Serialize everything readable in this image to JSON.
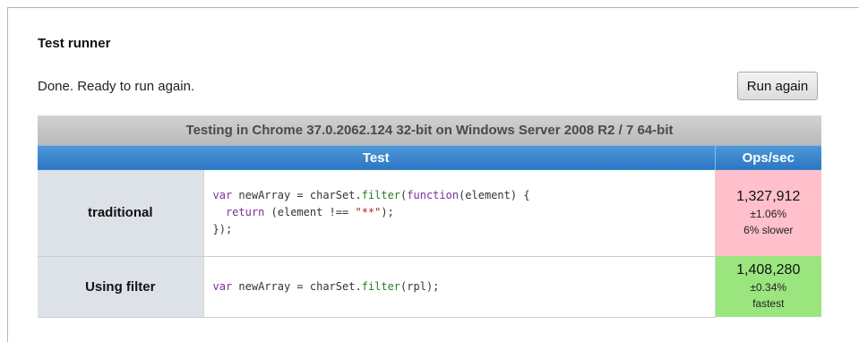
{
  "page": {
    "heading": "Test runner",
    "status": "Done. Ready to run again.",
    "run_button": "Run again"
  },
  "results": {
    "caption": "Testing in Chrome 37.0.2062.124 32-bit on Windows Server 2008 R2 / 7 64-bit",
    "headers": {
      "test": "Test",
      "ops": "Ops/sec"
    },
    "colors": {
      "slower": "#ffc0cb",
      "fastest": "#9be57f",
      "header": "#2a76c2"
    },
    "rows": [
      {
        "name": "traditional",
        "code_lines": [
          "var newArray = charSet.filter(function(element) {",
          "  return (element !== \"**\");",
          "});"
        ],
        "ops": "1,327,912",
        "error": "±1.06%",
        "rank": "6% slower"
      },
      {
        "name": "Using filter",
        "code_lines": [
          "var newArray = charSet.filter(rpl);"
        ],
        "ops": "1,408,280",
        "error": "±0.34%",
        "rank": "fastest"
      }
    ]
  }
}
